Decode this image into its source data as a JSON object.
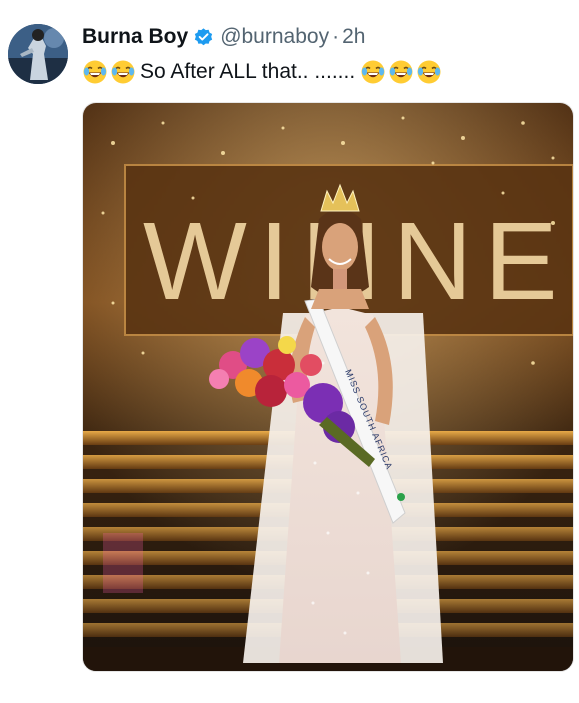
{
  "tweet": {
    "display_name": "Burna Boy",
    "handle": "@burnaboy",
    "separator": "·",
    "timestamp": "2h",
    "text": "So After ALL that.. .......",
    "leading_emojis": [
      "joy-emoji",
      "joy-emoji"
    ],
    "trailing_emojis": [
      "joy-emoji",
      "joy-emoji",
      "joy-emoji"
    ],
    "verified": true
  },
  "media": {
    "backdrop_sign": "WINNE",
    "sash_text": "MISS SOUTH AFRICA"
  },
  "colors": {
    "verified_blue": "#1d9bf0",
    "secondary_text": "#536471",
    "primary_text": "#0f1419"
  }
}
